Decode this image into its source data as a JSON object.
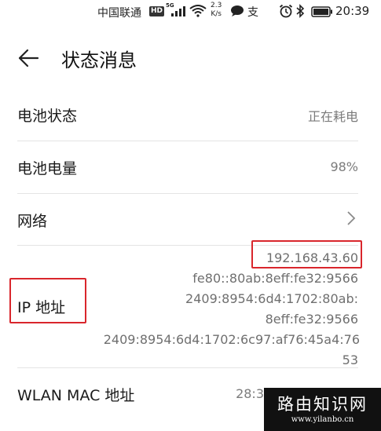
{
  "status_bar": {
    "carrier": "中国联通",
    "hd_badge": "HD",
    "network_type": "5G",
    "speed_value": "2.3",
    "speed_unit": "K/s",
    "app_glyph": "支",
    "time": "20:39",
    "icons": [
      "signal-icon",
      "wifi-icon",
      "message-icon",
      "alipay-icon",
      "alarm-icon",
      "bluetooth-icon",
      "battery-icon"
    ]
  },
  "header": {
    "title": "状态消息",
    "back_icon": "back-arrow-icon"
  },
  "rows": [
    {
      "label": "电池状态",
      "value": "正在耗电"
    },
    {
      "label": "电池电量",
      "value": "98%"
    },
    {
      "label": "网络",
      "value": "",
      "icon": "chevron-right-icon"
    }
  ],
  "ip": {
    "label": "IP 地址",
    "lines": [
      "192.168.43.60",
      "fe80::80ab:8eff:fe32:9566",
      "2409:8954:6d4:1702:80ab:",
      "8eff:fe32:9566",
      "2409:8954:6d4:1702:6c97:af76:45a4:76",
      "53"
    ]
  },
  "wlan_mac": {
    "label": "WLAN MAC 地址",
    "value": "28:3"
  },
  "watermark": {
    "title": "路由知识网",
    "url": "www.yilanbo.cn"
  },
  "colors": {
    "highlight_box": "#d9262c",
    "value_text": "#7b7b7b",
    "divider": "#e4e4e4"
  }
}
